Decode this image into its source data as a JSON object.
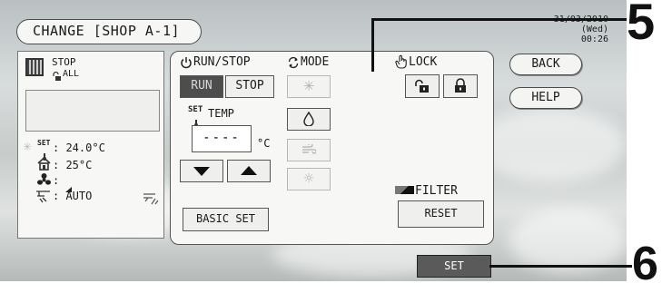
{
  "header": {
    "title": "CHANGE [SHOP A-1]",
    "date": "31/03/2010",
    "day_time": "(Wed) 00:26"
  },
  "side_buttons": {
    "back": "BACK",
    "help": "HELP"
  },
  "status": {
    "state": "STOP",
    "group": "ALL",
    "set_label": "SET",
    "set_temp": ": 24.0°C",
    "room_temp": ": 25°C",
    "fan": ":",
    "louver": ": AUTO"
  },
  "run_stop": {
    "title": "RUN/STOP",
    "run": "RUN",
    "stop": "STOP"
  },
  "temp": {
    "label": "TEMP",
    "set_label": "SET",
    "value": "----",
    "unit": "°C"
  },
  "mode": {
    "title": "MODE"
  },
  "lock": {
    "title": "LOCK"
  },
  "filter": {
    "label": "FILTER",
    "reset": "RESET"
  },
  "basic_set": "BASIC SET",
  "set_button": "SET",
  "callouts": {
    "top": "5",
    "bottom": "6"
  },
  "colors": {
    "panel": "#f7f7f5",
    "run_active": "#4d4d4d",
    "set_button": "#5a5a5a"
  }
}
